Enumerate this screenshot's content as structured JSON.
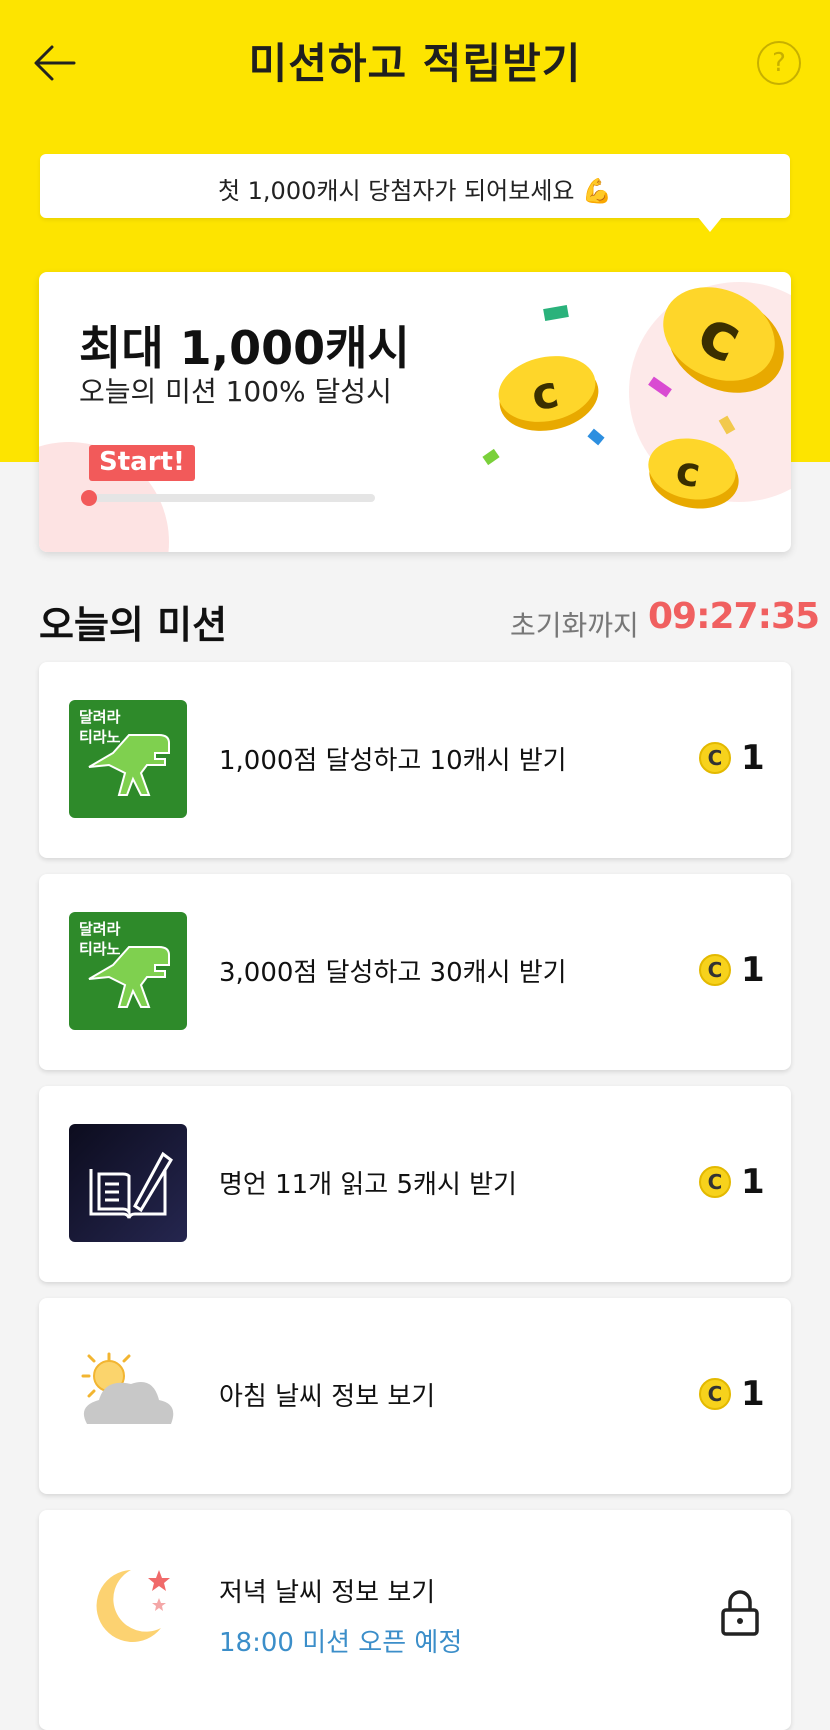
{
  "header": {
    "title": "미션하고 적립받기",
    "help_symbol": "?"
  },
  "banner": {
    "bubble_text": "첫 1,000캐시 당첨자가 되어보세요 💪"
  },
  "hero": {
    "title": "최대 1,000캐시",
    "subtitle": "오늘의 미션 100% 달성시",
    "start_label": "Start!",
    "progress": 0
  },
  "section": {
    "title": "오늘의 미션",
    "reset_label": "초기화까지",
    "reset_timer": "09:27:35"
  },
  "missions": [
    {
      "text": "1,000점 달성하고 10캐시 받기",
      "reward": "1",
      "thumb": "dino-game-thumb",
      "thumb_label_1": "달려라",
      "thumb_label_2": "티라노"
    },
    {
      "text": "3,000점 달성하고 30캐시 받기",
      "reward": "1",
      "thumb": "dino-game-thumb",
      "thumb_label_1": "달려라",
      "thumb_label_2": "티라노"
    },
    {
      "text": "명언 11개 읽고 5캐시 받기",
      "reward": "1",
      "thumb": "book-pen-thumb"
    },
    {
      "text": "아침 날씨 정보 보기",
      "reward": "1",
      "thumb": "sun-cloud-icon"
    },
    {
      "text": "저녁 날씨 정보 보기",
      "subtext": "18:00 미션 오픈 예정",
      "thumb": "moon-stars-icon",
      "locked": true
    }
  ],
  "coin_symbol": "C",
  "colors": {
    "header_yellow": "#fde400",
    "accent_red": "#f25a5a",
    "coin_yellow": "#f7d21c",
    "link_blue": "#3b8ec9"
  }
}
